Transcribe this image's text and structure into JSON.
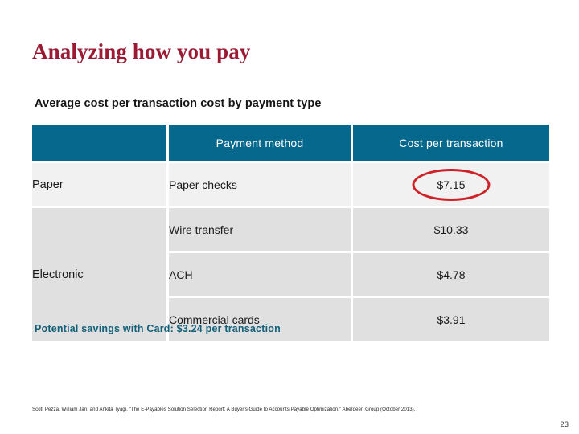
{
  "slide": {
    "title": "Analyzing how you pay",
    "subtitle": "Average cost per transaction cost by payment type",
    "savings_note": "Potential savings with Card: $3.24 per transaction",
    "footnote": "Scott Pezza, William Jan, and Ankita Tyagi, \"The E-Payables Solution Selection Report: A Buyer's Guide to Accounts Payable Optimization,\" Aberdeen Group (October 2013).",
    "page_number": "23"
  },
  "colors": {
    "title": "#9b1b34",
    "table_header_bg": "#06688c",
    "row_light": "#f1f1f1",
    "row_dark": "#e0e0e0",
    "highlight_red": "#cf2127",
    "note_teal": "#13607a"
  },
  "table": {
    "headers": {
      "category": "",
      "method": "Payment method",
      "cost": "Cost per transaction"
    },
    "groups": [
      {
        "category": "Paper",
        "rows": [
          {
            "method": "Paper checks",
            "cost": "$7.15",
            "highlighted": true
          }
        ]
      },
      {
        "category": "Electronic",
        "rows": [
          {
            "method": "Wire transfer",
            "cost": "$10.33",
            "highlighted": false
          },
          {
            "method": "ACH",
            "cost": "$4.78",
            "highlighted": false
          },
          {
            "method": "Commercial cards",
            "cost": "$3.91",
            "highlighted": false
          }
        ]
      }
    ]
  }
}
